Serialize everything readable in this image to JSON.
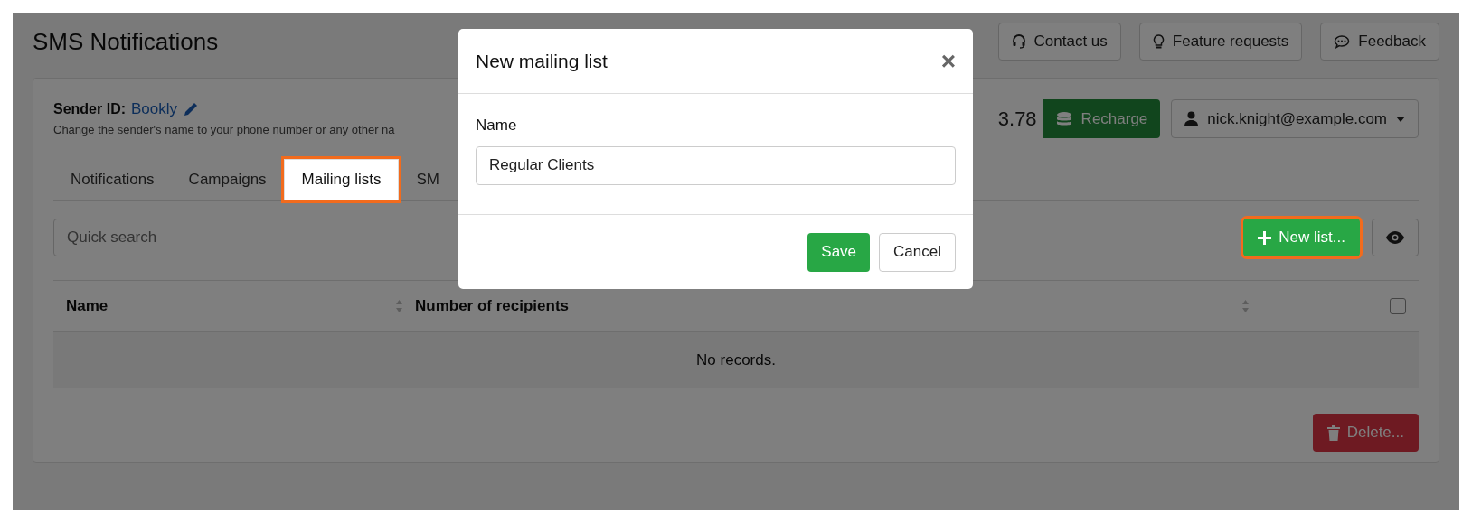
{
  "page_title": "SMS Notifications",
  "header_buttons": [
    {
      "kind": "contact",
      "label": "Contact us"
    },
    {
      "kind": "feature",
      "label": "Feature requests"
    },
    {
      "kind": "feedback",
      "label": "Feedback"
    }
  ],
  "sender": {
    "label": "Sender ID:",
    "value": "Bookly",
    "hint": "Change the sender's name to your phone number or any other na"
  },
  "balance": "3.78",
  "recharge_button": "Recharge",
  "account": "nick.knight@example.com",
  "tabs": [
    {
      "label": "Notifications",
      "selected": false,
      "highlighted": false
    },
    {
      "label": "Campaigns",
      "selected": false,
      "highlighted": false
    },
    {
      "label": "Mailing lists",
      "selected": true,
      "highlighted": true
    },
    {
      "label": "SM",
      "selected": false,
      "highlighted": false
    }
  ],
  "search": {
    "placeholder": "Quick search"
  },
  "new_list_button": {
    "label": "New list...",
    "highlighted": true
  },
  "table": {
    "columns": [
      "Name",
      "Number of recipients"
    ],
    "select_all_checked": false,
    "empty_message": "No records."
  },
  "delete_button": "Delete...",
  "dialog": {
    "title": "New mailing list",
    "close": "×",
    "field_label": "Name",
    "field_value": "Regular Clients",
    "save": "Save",
    "cancel": "Cancel"
  }
}
